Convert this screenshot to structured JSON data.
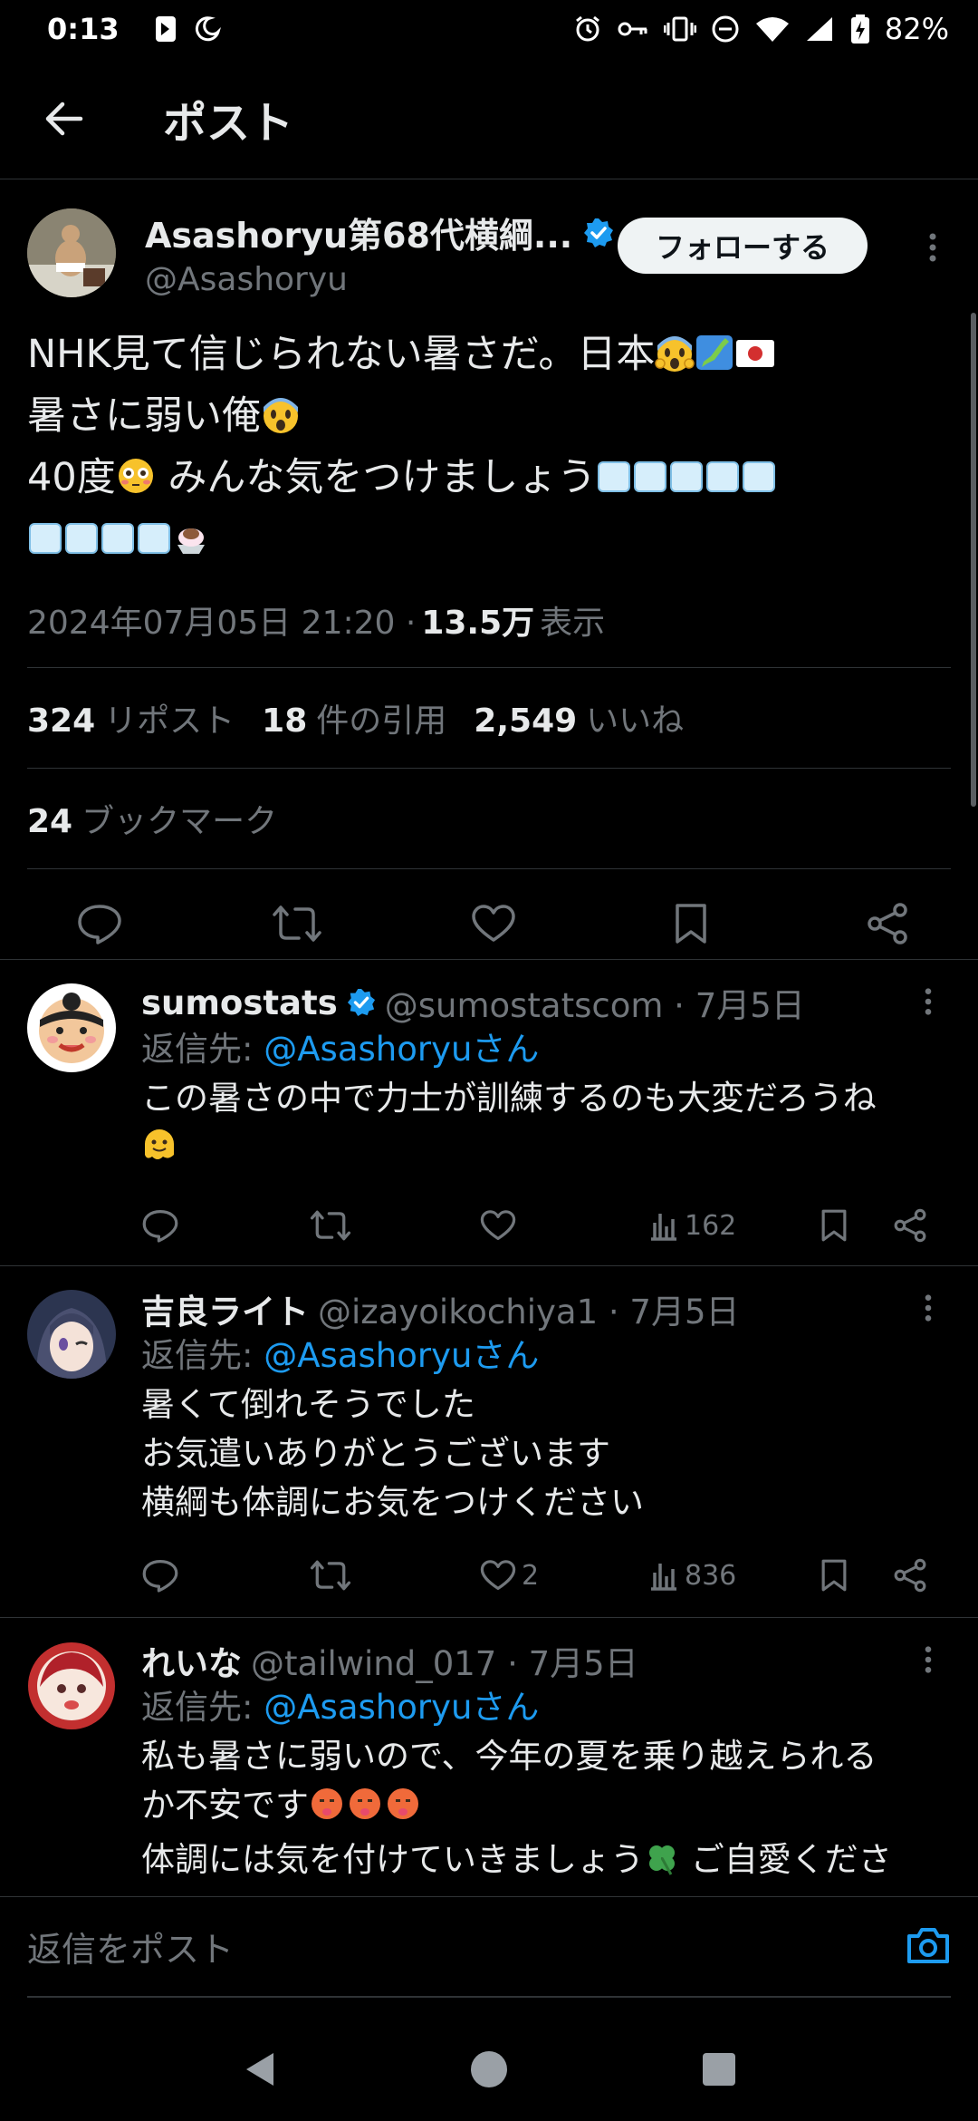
{
  "status_bar": {
    "time": "0:13",
    "battery": "82%"
  },
  "header": {
    "title": "ポスト"
  },
  "main_tweet": {
    "author_name": "Asashoryu第68代横綱...",
    "author_handle": "@Asashoryu",
    "follow_label": "フォローする",
    "text_lines": [
      "NHK見て信じられない暑さだ。日本",
      "暑さに弱い俺",
      "40度",
      " みんな気をつけましょう"
    ],
    "date": "2024年07月05日 21:20 · ",
    "views_count": "13.5万",
    "views_label": "表示",
    "reposts_count": "324",
    "reposts_label": "リポスト",
    "quotes_count": "18",
    "quotes_label": "件の引用",
    "likes_count": "2,549",
    "likes_label": "いいね",
    "bookmarks_count": "24",
    "bookmarks_label": "ブックマーク"
  },
  "replies": [
    {
      "name": "sumostats",
      "handle": "@sumostatscom · 7月5日",
      "replying_prefix": "返信先: ",
      "replying_to": "@Asashoryuさん",
      "lines": [
        "この暑さの中で力士が訓練するのも大変だろうね"
      ],
      "likes": "",
      "views": "162"
    },
    {
      "name": "吉良ライト",
      "handle": "@izayoikochiya1 · 7月5日",
      "replying_prefix": "返信先: ",
      "replying_to": "@Asashoryuさん",
      "lines": [
        "暑くて倒れそうでした",
        "お気遣いありがとうございます",
        "横綱も体調にお気をつけください"
      ],
      "likes": "2",
      "views": "836"
    },
    {
      "name": "れいな",
      "handle": "@tailwind_017 · 7月5日",
      "replying_prefix": "返信先: ",
      "replying_to": "@Asashoryuさん",
      "lines": [
        "私も暑さに弱いので、今年の夏を乗り越えられる",
        "か不安です",
        "体調には気を付けていきましょう",
        " ご自愛くださ"
      ],
      "likes": "",
      "views": ""
    }
  ],
  "compose": {
    "placeholder": "返信をポスト"
  },
  "colors": {
    "accent": "#1d9bf0",
    "muted": "#71767b",
    "text": "#e7e9ea",
    "background": "#000000",
    "divider": "#2f3336"
  }
}
